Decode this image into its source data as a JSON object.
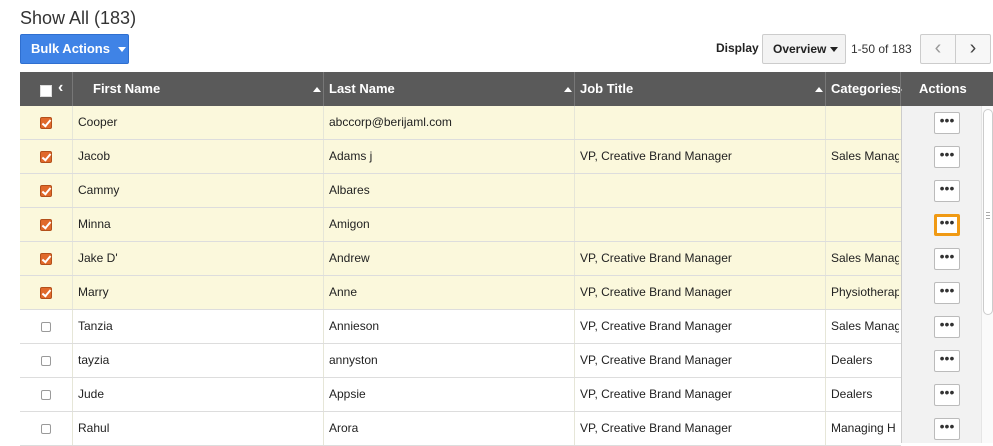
{
  "header": {
    "title": "Show All (183)",
    "bulk_actions_label": "Bulk Actions",
    "display_label": "Display",
    "display_value": "Overview",
    "pager_text": "1-50 of 183",
    "prev_glyph": "‹",
    "next_glyph": "›"
  },
  "table": {
    "columns": {
      "first_name": "First Name",
      "last_name": "Last Name",
      "job_title": "Job Title",
      "categories": "Categories",
      "actions": "Actions"
    },
    "header_prev_glyph": "‹",
    "header_next_glyph": "›",
    "action_glyph": "•••",
    "rows": [
      {
        "selected": true,
        "first": "Cooper",
        "last": "abccorp@berijaml.com",
        "job": "",
        "category": ""
      },
      {
        "selected": true,
        "first": "Jacob",
        "last": "Adams j",
        "job": "VP, Creative Brand Manager",
        "category": "Sales Manag"
      },
      {
        "selected": true,
        "first": "Cammy",
        "last": "Albares",
        "job": "",
        "category": ""
      },
      {
        "selected": true,
        "first": "Minna",
        "last": "Amigon",
        "job": "",
        "category": ""
      },
      {
        "selected": true,
        "first": "Jake D'",
        "last": "Andrew",
        "job": "VP, Creative Brand Manager",
        "category": "Sales Manag"
      },
      {
        "selected": true,
        "first": "Marry",
        "last": "Anne",
        "job": "VP, Creative Brand Manager",
        "category": "Physiotherap"
      },
      {
        "selected": false,
        "first": "Tanzia",
        "last": "Annieson",
        "job": "VP, Creative Brand Manager",
        "category": "Sales Manag"
      },
      {
        "selected": false,
        "first": "tayzia",
        "last": "annyston",
        "job": "VP, Creative Brand Manager",
        "category": "Dealers"
      },
      {
        "selected": false,
        "first": "Jude",
        "last": "Appsie",
        "job": "VP, Creative Brand Manager",
        "category": "Dealers"
      },
      {
        "selected": false,
        "first": "Rahul",
        "last": "Arora",
        "job": "VP, Creative Brand Manager",
        "category": "Managing H"
      }
    ]
  },
  "colors": {
    "accent": "#3f83e6",
    "selected_row": "#fbf8dc",
    "checkbox_checked": "#e0692b",
    "focus_outline": "#f09a14",
    "header_bg": "#5a5a5a"
  }
}
